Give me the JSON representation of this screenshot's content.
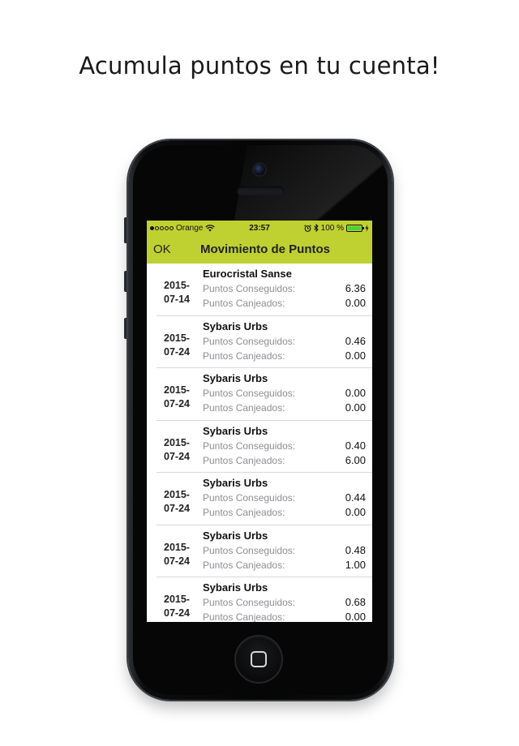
{
  "headline": "Acumula puntos en tu cuenta!",
  "status_bar": {
    "carrier": "Orange",
    "time": "23:57",
    "battery": "100 %"
  },
  "nav": {
    "ok_label": "OK",
    "title": "Movimiento de Puntos"
  },
  "labels": {
    "earned": "Puntos Conseguidos:",
    "redeemed": "Puntos Canjeados:"
  },
  "colors": {
    "accent": "#bfd131"
  },
  "movements": [
    {
      "date_year": "2015-",
      "date_rest": "07-14",
      "store": "Eurocristal Sanse",
      "earned": "6.36",
      "redeemed": "0.00"
    },
    {
      "date_year": "2015-",
      "date_rest": "07-24",
      "store": "Sybaris Urbs",
      "earned": "0.46",
      "redeemed": "0.00"
    },
    {
      "date_year": "2015-",
      "date_rest": "07-24",
      "store": "Sybaris Urbs",
      "earned": "0.00",
      "redeemed": "0.00"
    },
    {
      "date_year": "2015-",
      "date_rest": "07-24",
      "store": "Sybaris Urbs",
      "earned": "0.40",
      "redeemed": "6.00"
    },
    {
      "date_year": "2015-",
      "date_rest": "07-24",
      "store": "Sybaris Urbs",
      "earned": "0.44",
      "redeemed": "0.00"
    },
    {
      "date_year": "2015-",
      "date_rest": "07-24",
      "store": "Sybaris Urbs",
      "earned": "0.48",
      "redeemed": "1.00"
    },
    {
      "date_year": "2015-",
      "date_rest": "07-24",
      "store": "Sybaris Urbs",
      "earned": "0.68",
      "redeemed": "0.00"
    }
  ]
}
